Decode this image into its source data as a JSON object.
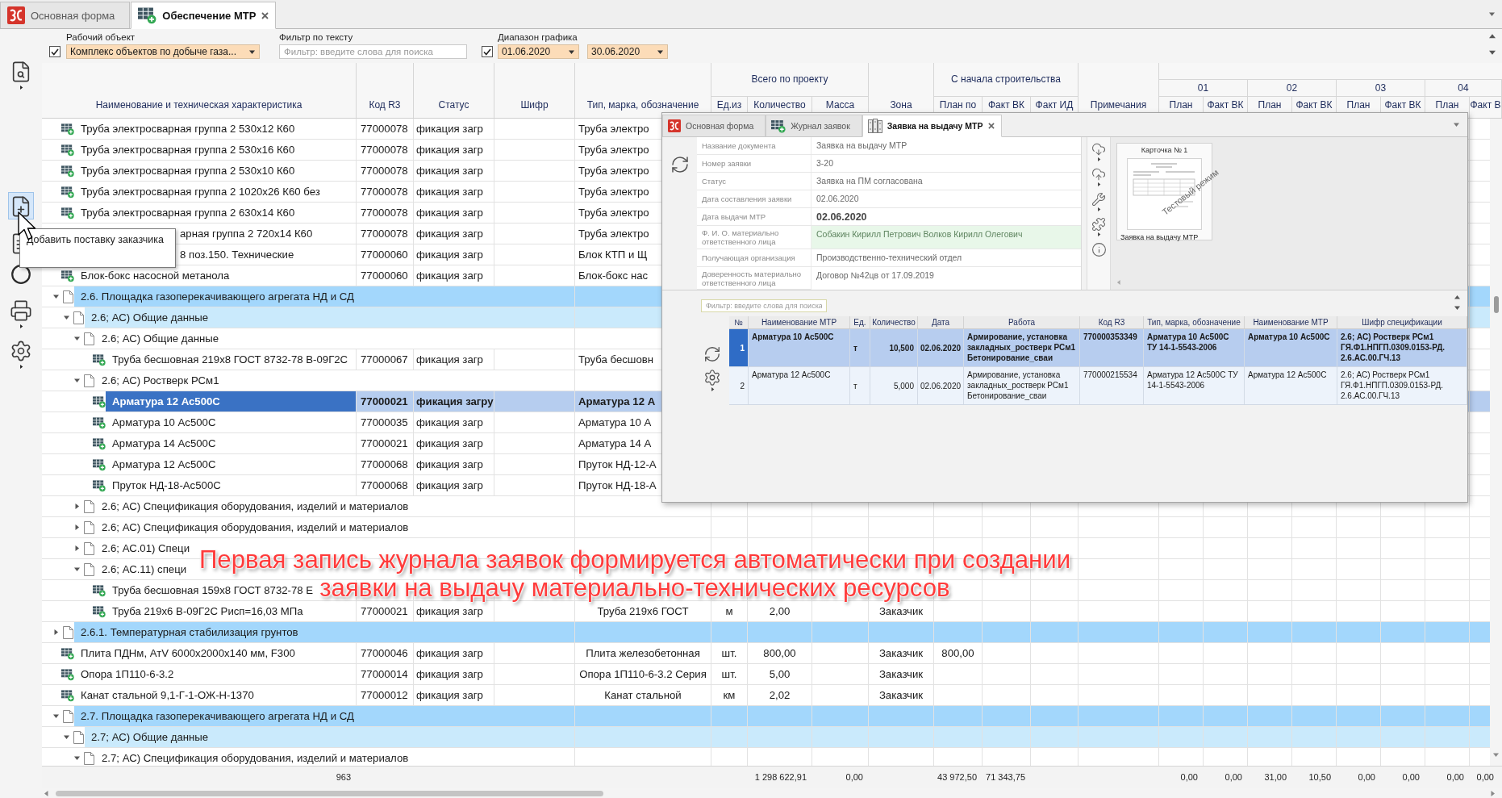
{
  "tabs": [
    {
      "label": "Основная форма",
      "kind": "home",
      "selected": false,
      "closable": false
    },
    {
      "label": "Обеспечение МТР",
      "kind": "supply",
      "selected": true,
      "closable": true
    }
  ],
  "filters": {
    "work_object": {
      "label": "Рабочий объект",
      "checked": true,
      "value": "Комплекс объектов по добыче газа..."
    },
    "text_filter": {
      "label": "Фильтр по тексту",
      "placeholder": "Фильтр: введите слова для поиска"
    },
    "schedule_range": {
      "label": "Диапазон графика",
      "checked": true,
      "from": "01.06.2020",
      "to": "30.06.2020"
    }
  },
  "toolbar": [
    {
      "kind": "find",
      "hovered": false,
      "dropdown": true
    },
    {
      "kind": "add",
      "hovered": true,
      "dropdown": false
    },
    {
      "kind": "document",
      "hovered": false,
      "dropdown": false
    },
    {
      "kind": "ring",
      "hovered": false,
      "dropdown": false
    },
    {
      "kind": "print",
      "hovered": false,
      "dropdown": true
    },
    {
      "kind": "settings",
      "hovered": false,
      "dropdown": true
    }
  ],
  "tooltip": {
    "text": "Добавить поставку заказчика"
  },
  "grid": {
    "header": [
      {
        "kind": "single",
        "label": "Наименование и техническая характеристика"
      },
      {
        "kind": "single",
        "label": "Код R3"
      },
      {
        "kind": "single",
        "label": "Статус"
      },
      {
        "kind": "single",
        "label": "Шифр"
      },
      {
        "kind": "single",
        "label": "Тип, марка, обозначение"
      },
      {
        "kind": "group",
        "label": "Всего по проекту",
        "columns": [
          "Ед.из",
          "Количество",
          "Масса"
        ]
      },
      {
        "kind": "single",
        "label": "Зона"
      },
      {
        "kind": "group",
        "label": "С начала строительства",
        "columns": [
          "План по",
          "Факт ВК",
          "Факт ИД"
        ]
      },
      {
        "kind": "single",
        "label": "Примечания"
      },
      {
        "kind": "periods",
        "periods": [
          {
            "label": "01",
            "columns": [
              "План",
              "Факт ВК"
            ]
          },
          {
            "label": "02",
            "columns": [
              "План",
              "Факт ВК"
            ]
          },
          {
            "label": "03",
            "columns": [
              "План",
              "Факт ВК"
            ]
          },
          {
            "label": "04",
            "columns": [
              "План",
              "Факт В"
            ]
          }
        ]
      }
    ],
    "rows": [
      {
        "kind": "item",
        "name": "Труба электросварная группа 2 530х12 К60",
        "code": "77000078",
        "status": "фикация загр",
        "type_mark": "Труба электро",
        "selected": false
      },
      {
        "kind": "item",
        "name": "Труба электросварная группа 2 530х16 К60",
        "code": "77000078",
        "status": "фикация загр",
        "type_mark": "Труба электро",
        "selected": false
      },
      {
        "kind": "item",
        "name": "Труба электросварная группа 2 530х10 К60",
        "code": "77000078",
        "status": "фикация загр",
        "type_mark": "Труба электро",
        "selected": false
      },
      {
        "kind": "item",
        "name": "Труба электросварная группа 2 1020х26 К60 без",
        "code": "77000078",
        "status": "фикация загр",
        "type_mark": "Труба электро",
        "selected": false
      },
      {
        "kind": "item",
        "name": "Труба электросварная группа 2 630х14 К60",
        "code": "77000078",
        "status": "фикация загр",
        "type_mark": "Труба электро",
        "selected": false
      },
      {
        "kind": "item",
        "name": "арная группа 2 720х14 К60",
        "code": "77000078",
        "status": "фикация загр",
        "type_mark": "Труба электро",
        "selected": false
      },
      {
        "kind": "item",
        "name": "8 поз.150. Технические",
        "code": "77000060",
        "status": "фикация загр",
        "type_mark": "Блок КТП и Щ",
        "selected": false
      },
      {
        "kind": "item",
        "name": "Блок-бокс насосной метанола",
        "code": "77000060",
        "status": "фикация загр",
        "type_mark": "Блок-бокс нас",
        "selected": false
      },
      {
        "kind": "group",
        "name": "2.6. Площадка газоперекачивающего агрегата НД и СД",
        "expanded": true,
        "selected": false,
        "children": [
          {
            "kind": "group",
            "name": "2.6; АС) Общие данные",
            "expanded": true,
            "selected": false,
            "children": [
              {
                "kind": "group",
                "name": "2.6; АС) Общие данные",
                "expanded": true,
                "selected": false,
                "children": [
                  {
                    "kind": "item",
                    "name": "Труба бесшовная 219х8 ГОСТ 8732-78 В-09Г2С",
                    "code": "77000067",
                    "status": "фикация загр",
                    "type_mark": "Труба бесшовн",
                    "selected": false
                  }
                ]
              },
              {
                "kind": "group",
                "name": "2.6; АС) Ростверк РСм1",
                "expanded": true,
                "selected": false,
                "children": [
                  {
                    "kind": "item",
                    "name": "Арматура 12 Ас500С",
                    "code": "77000021",
                    "status": "фикация загру",
                    "type_mark": "Арматура 12 А",
                    "selected": true
                  },
                  {
                    "kind": "item",
                    "name": "Арматура 10 Ас500С",
                    "code": "77000035",
                    "status": "фикация загр",
                    "type_mark": "Арматура 10 А",
                    "selected": false
                  },
                  {
                    "kind": "item",
                    "name": "Арматура 14 Ас500С",
                    "code": "77000021",
                    "status": "фикация загр",
                    "type_mark": "Арматура 14 А",
                    "selected": false
                  },
                  {
                    "kind": "item",
                    "name": "Арматура 12 Ас500С",
                    "code": "77000068",
                    "status": "фикация загр",
                    "type_mark": "Пруток НД-12-А",
                    "selected": false
                  },
                  {
                    "kind": "item",
                    "name": "Пруток НД-18-Ас500С",
                    "code": "77000068",
                    "status": "фикация загр",
                    "type_mark": "Пруток НД-18-А",
                    "selected": false
                  }
                ]
              },
              {
                "kind": "group",
                "name": "2.6; АС) Спецификация оборудования, изделий и материалов",
                "expanded": false,
                "selected": false
              },
              {
                "kind": "group",
                "name": "2.6; АС) Спецификация оборудования, изделий и материалов",
                "expanded": false,
                "selected": false
              },
              {
                "kind": "group",
                "name": "2.6; АС.01) Специ",
                "expanded": false,
                "selected": false
              },
              {
                "kind": "group",
                "name": "2.6; АС.11) специ",
                "expanded": true,
                "selected": false,
                "children": [
                  {
                    "kind": "item",
                    "name": "Труба бесшовная 159х8 ГОСТ 8732-78 Е",
                    "selected": false
                  },
                  {
                    "kind": "item",
                    "name": "Труба 219х6 В-09Г2С Рисп=16,03 МПа",
                    "code": "77000021",
                    "status": "фикация загр",
                    "type_mark": "Труба 219х6 ГОСТ",
                    "unit": "м",
                    "quantity": "2,00",
                    "zone": "Заказчик",
                    "selected": false
                  }
                ]
              }
            ]
          }
        ]
      },
      {
        "kind": "group",
        "name": "2.6.1. Температурная стабилизация грунтов",
        "expanded": false,
        "selected": false
      },
      {
        "kind": "item",
        "name": "Плита ПДНм, АтV 6000х2000х140 мм, F300",
        "code": "77000046",
        "status": "фикация загр",
        "type_mark": "Плита железобетонная",
        "unit": "шт.",
        "quantity": "800,00",
        "zone": "Заказчик",
        "plan_to_date": "800,00",
        "selected": false
      },
      {
        "kind": "item",
        "name": "Опора 1П110-6-3.2",
        "code": "77000014",
        "status": "фикация загр",
        "type_mark": "Опора 1П110-6-3.2 Серия",
        "unit": "шт.",
        "quantity": "5,00",
        "zone": "Заказчик",
        "selected": false
      },
      {
        "kind": "item",
        "name": "Канат стальной 9,1-Г-1-ОЖ-Н-1370",
        "code": "77000012",
        "status": "фикация загр",
        "type_mark": "Канат стальной",
        "unit": "км",
        "quantity": "2,02",
        "zone": "Заказчик",
        "selected": false
      },
      {
        "kind": "group",
        "name": "2.7. Площадка газоперекачивающего агрегата НД и СД",
        "expanded": true,
        "selected": false,
        "children": [
          {
            "kind": "group",
            "name": "2.7; АС) Общие данные",
            "expanded": true,
            "selected": false,
            "children": [
              {
                "kind": "group",
                "name": "2.7; АС) Спецификация оборудования, изделий и материалов",
                "expanded": true,
                "selected": false
              }
            ]
          }
        ]
      }
    ],
    "totals": {
      "name": "963",
      "quantity": "1 298 622,91",
      "mass": "0,00",
      "plan_to_date": "43 972,50",
      "fact_vk_to_date": "71 343,75",
      "p01_plan": "0,00",
      "p01_fact": "0,00",
      "p02_plan": "31,00",
      "p02_fact": "10,50",
      "p03_plan": "0,00",
      "p03_fact": "0,00",
      "p04_plan": "0,00",
      "p04_fact": "0,00"
    }
  },
  "request_window": {
    "tabs": [
      {
        "label": "Основная форма",
        "kind": "home",
        "selected": false,
        "closable": false
      },
      {
        "label": "Журнал заявок",
        "kind": "journal",
        "selected": false,
        "closable": false
      },
      {
        "label": "Заявка на выдачу МТР",
        "kind": "request",
        "selected": true,
        "closable": true
      }
    ],
    "fields": [
      {
        "label": "Название документа",
        "value": "Заявка на выдачу МТР",
        "kind": "plain"
      },
      {
        "label": "Номер заявки",
        "value": "3-20",
        "kind": "plain"
      },
      {
        "label": "Статус",
        "value": "Заявка на ПМ согласована",
        "kind": "plain"
      },
      {
        "label": "Дата составления заявки",
        "value": "02.06.2020",
        "kind": "plain"
      },
      {
        "label": "Дата выдачи МТР",
        "value": "02.06.2020",
        "kind": "emphasized"
      },
      {
        "label": "Ф. И. О. материально ответственного лица",
        "value": "Собакин Кирилл Петрович Волков Кирилл Олегович",
        "kind": "highlighted"
      },
      {
        "label": "Получающая организация",
        "value": "Производственно-технический отдел",
        "kind": "plain"
      },
      {
        "label": "Доверенность материально ответственного лица",
        "value": "Договор №42цв от 17.09.2019",
        "kind": "plain"
      }
    ],
    "card": {
      "title": "Карточка № 1",
      "stamp": "Тестовый режим",
      "caption": "Заявка на выдачу МТР"
    },
    "filter": {
      "placeholder": "Фильтр: введите слова для поиска"
    },
    "table": {
      "columns": [
        "№",
        "Наименование МТР",
        "Ед.",
        "Количество",
        "Дата",
        "Работа",
        "Код R3",
        "Тип, марка, обозначение",
        "Наименование МТР",
        "Шифр спецификации"
      ],
      "rows": [
        {
          "selected": true,
          "cells": [
            "1",
            "Арматура 10 Ас500С",
            "т",
            "10,500",
            "02.06.2020",
            "Армирование, установка закладных_ростверк РСм1 Бетонирование_сваи",
            "770000353349",
            "Арматура 10 Ас500С ТУ 14-1-5543-2006",
            "Арматура 10 Ас500С",
            "2.6; АС) Ростверк РСм1 ГЯ.Ф1.НПГП.0309.0153-РД. 2.6.АС.00.ГЧ.13"
          ]
        },
        {
          "selected": false,
          "cells": [
            "2",
            "Арматура 12 Ас500С",
            "т",
            "5,000",
            "02.06.2020",
            "Армирование, установка закладных_ростверк РСм1 Бетонирование_сваи",
            "770000215534",
            "Арматура 12 Ас500С ТУ 14-1-5543-2006",
            "Арматура 12 Ас500С",
            "2.6; АС) Ростверк РСм1 ГЯ.Ф1.НПГП.0309.0153-РД. 2.6.АС.00.ГЧ.13"
          ]
        }
      ]
    }
  },
  "annotation": {
    "lines": [
      "Первая запись журнала заявок формируется автоматически при создании",
      "заявки на выдачу материально-технических ресурсов"
    ]
  }
}
